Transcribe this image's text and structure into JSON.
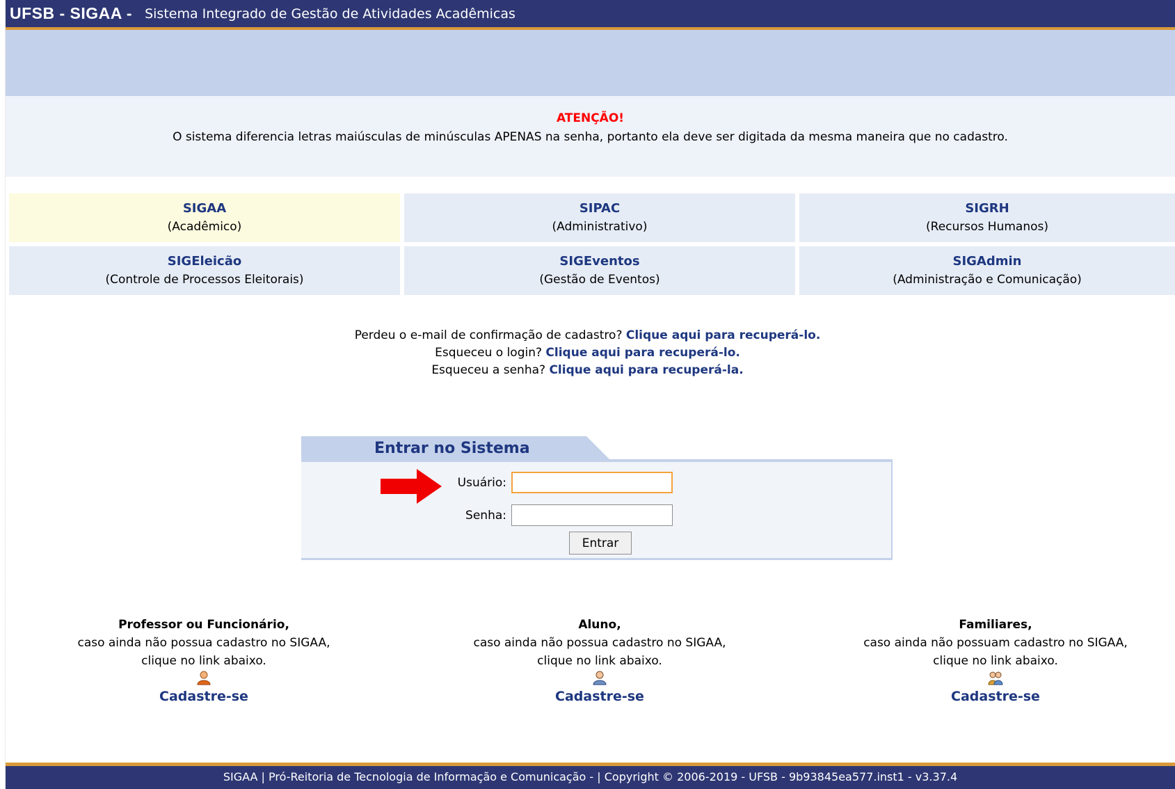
{
  "header": {
    "brand": "UFSB - SIGAA -",
    "subtitle": "Sistema Integrado de Gestão de Atividades Acadêmicas"
  },
  "notice": {
    "title": "ATENÇÃO!",
    "message": "O sistema diferencia letras maiúsculas de minúsculas APENAS na senha, portanto ela deve ser digitada da mesma maneira que no cadastro."
  },
  "systems": [
    {
      "name": "SIGAA",
      "desc": "(Acadêmico)"
    },
    {
      "name": "SIPAC",
      "desc": "(Administrativo)"
    },
    {
      "name": "SIGRH",
      "desc": "(Recursos Humanos)"
    },
    {
      "name": "SIGEleicão",
      "desc": "(Controle de Processos Eleitorais)"
    },
    {
      "name": "SIGEventos",
      "desc": "(Gestão de Eventos)"
    },
    {
      "name": "SIGAdmin",
      "desc": "(Administração e Comunicação)"
    }
  ],
  "recover": {
    "line1_text": "Perdeu o e-mail de confirmação de cadastro? ",
    "line1_link": "Clique aqui para recuperá-lo.",
    "line2_text": "Esqueceu o login? ",
    "line2_link": "Clique aqui para recuperá-lo.",
    "line3_text": "Esqueceu a senha? ",
    "line3_link": "Clique aqui para recuperá-la."
  },
  "login": {
    "title": "Entrar no Sistema",
    "user_label": "Usuário:",
    "user_value": "",
    "password_label": "Senha:",
    "password_value": "",
    "submit_label": "Entrar"
  },
  "register": [
    {
      "who": "Professor ou Funcionário,",
      "line1": "caso ainda não possua cadastro no SIGAA,",
      "line2": "clique no link abaixo.",
      "icon": "user-orange-icon",
      "link": "Cadastre-se"
    },
    {
      "who": "Aluno,",
      "line1": "caso ainda não possua cadastro no SIGAA,",
      "line2": "clique no link abaixo.",
      "icon": "user-student-icon",
      "link": "Cadastre-se"
    },
    {
      "who": "Familiares,",
      "line1": "caso ainda não possuam cadastro no SIGAA,",
      "line2": "clique no link abaixo.",
      "icon": "users-family-icon",
      "link": "Cadastre-se"
    }
  ],
  "footer": {
    "text": "SIGAA | Pró-Reitoria de Tecnologia de Informação e Comunicação -   | Copyright © 2006-2019 - UFSB - 9b93845ea577.inst1 - v3.37.4"
  },
  "colors": {
    "header_bg": "#2e3773",
    "accent_orange": "#d99a3a",
    "band_blue": "#c4d1ea",
    "link_blue": "#1e3780",
    "alert_red": "#ff0000"
  }
}
